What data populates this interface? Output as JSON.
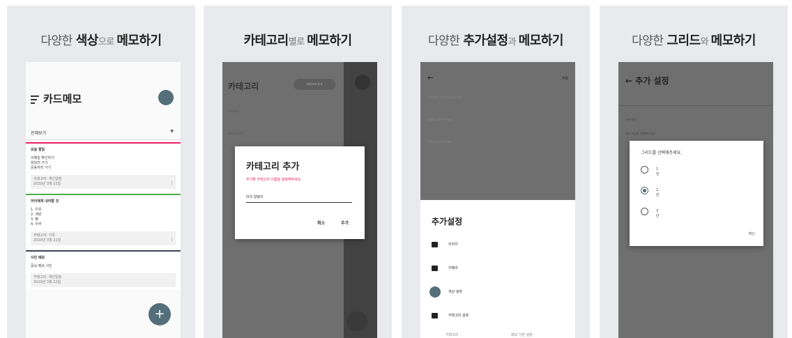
{
  "panels": [
    {
      "title_pre": "다양한 ",
      "title_bold": "색상",
      "title_mid": "으로 ",
      "title_bold2": "메모하기"
    },
    {
      "title_pre": "",
      "title_bold": "카테고리",
      "title_mid": "별로 ",
      "title_bold2": "메모하기"
    },
    {
      "title_pre": "다양한 ",
      "title_bold": "추가설정",
      "title_mid": "과 ",
      "title_bold2": "메모하기"
    },
    {
      "title_pre": "다양한 ",
      "title_bold": "그리드",
      "title_mid": "와 ",
      "title_bold2": "메모하기"
    }
  ],
  "screen1": {
    "app_title": "카드메모",
    "filter_label": "전체보기",
    "fab_label": "+",
    "cards": [
      {
        "title": "오늘 할일",
        "lines": [
          "이메일 확인하기",
          "장보러 가기",
          "운동하러 가기"
        ],
        "meta1": "카테고리: 개인일정",
        "meta2": "2020년 3월 22일",
        "accent": "#e91e63"
      },
      {
        "title": "아이에게 내야할 것",
        "lines": [
          "1. 우유",
          "2. 계란",
          "3. 빵",
          "4. 두부"
        ],
        "meta1": "카테고리: 가족",
        "meta2": "2020년 3월 22일",
        "accent": "#4caf50"
      },
      {
        "title": "사진 메모",
        "lines": [
          "중요 메모 사진"
        ],
        "meta1": "카테고리: 개인일정",
        "meta2": "2020년 3월 22일",
        "accent": "#37474f"
      }
    ]
  },
  "screen2": {
    "bg_title": "카테고리",
    "bg_button": "카테고리 추가",
    "bg_row1": "전체보기",
    "bg_row2": "카테고리 없음",
    "dialog_title": "카테고리 추가",
    "dialog_message": "추가할 카테고리 이름을 설정해주세요.",
    "input_value": "미리 알림이",
    "cancel_label": "취소",
    "add_label": "추가"
  },
  "screen3": {
    "back_icon": "arrow-left",
    "save_label": "저장",
    "ghost_lines": [
      "카테고리: 미리 알림이를 선택",
      "내용을 입력해주세요.",
      "제목을 입력해주세요."
    ],
    "sheet_title": "추가설정",
    "items": [
      {
        "label": "이미지",
        "icon": "image-icon"
      },
      {
        "label": "카메라",
        "icon": "camera-icon"
      },
      {
        "label": "색상 설정",
        "icon": "color-icon"
      },
      {
        "label": "카테고리 설정",
        "icon": "category-icon"
      }
    ],
    "bottom_left": "카테고리",
    "bottom_right": "메모 기본 설정"
  },
  "screen4": {
    "header": "← 추가 설정",
    "ghost1": "기본 설정",
    "ghost2": "메모 색상을 선택해주세요.",
    "dialog_title": "그리드를 선택해주세요.",
    "options": [
      {
        "label": "1단",
        "selected": false
      },
      {
        "label": "2단",
        "selected": true
      },
      {
        "label": "3단",
        "selected": false
      }
    ],
    "ok_label": "확인"
  },
  "colors": {
    "accent": "#546e7a",
    "pink": "#e91e63",
    "green": "#4caf50",
    "dark": "#37474f"
  }
}
